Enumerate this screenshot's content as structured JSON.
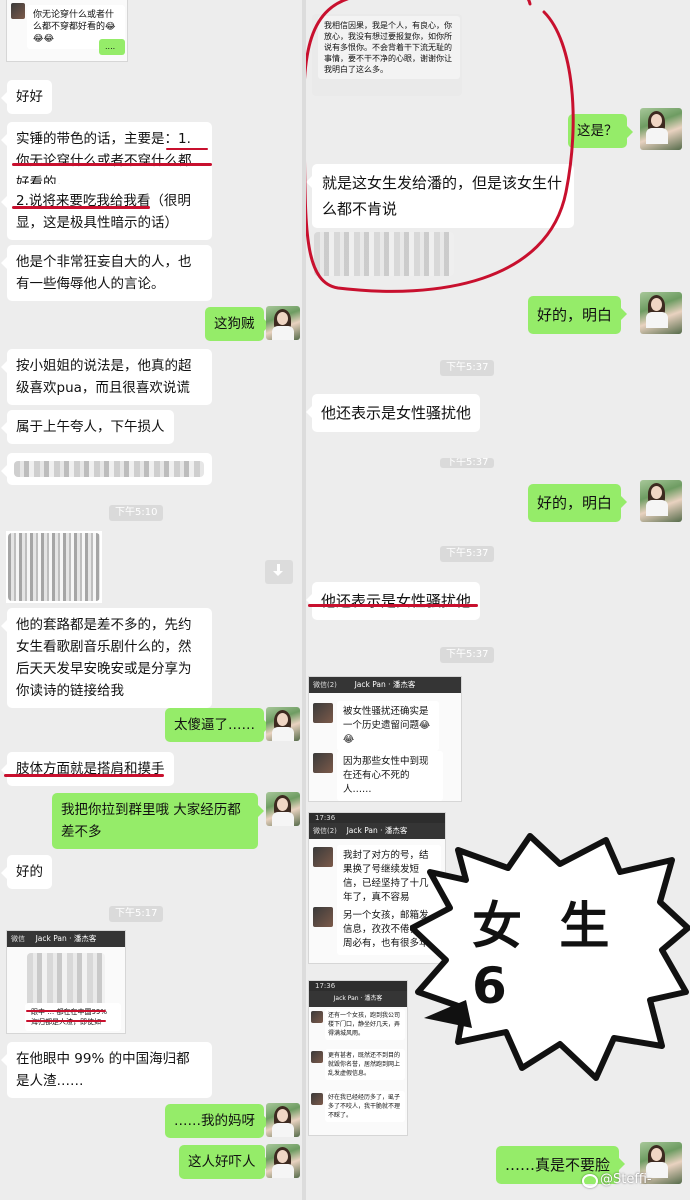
{
  "left": {
    "top_shot_text": "你无论穿什么或者什么都不穿都好看的😂😂😂",
    "msgs": {
      "haohao": "好好",
      "p1": "实锤的带色的话，主要是：1.你无论穿什么或者不穿什么都好看的。",
      "p2": "2.说将来要吃我给我看（很明显，这是极具性暗示的话）",
      "p3": "他是个非常狂妄自大的人，也有一些侮辱他人的言论。",
      "gouzei": "这狗贼",
      "p4": "按小姐姐的说法是，他真的超级喜欢pua，而且很喜欢说谎",
      "p5": "属于上午夸人，下午损人",
      "p6": "他的套路都是差不多的，先约女生看歌剧音乐剧什么的，然后天天发早安晚安或是分享为你读诗的链接给我",
      "shabi": "太傻逼了……",
      "p7": "肢体方面就是搭肩和摸手",
      "p8": "我把你拉到群里哦 大家经历都差不多",
      "haode": "好的",
      "p9": "在他眼中 99% 的中国海归都是人渣……",
      "mama": "……我的妈呀",
      "xiaren": "这人好吓人"
    },
    "timestamps": {
      "t1": "下午5:10",
      "t2": "下午5:17"
    },
    "shot2": {
      "title": "Jack Pan · 潘杰客",
      "back": "微信",
      "lines": "跟中 … 都在在中国99% 海归都是人渣，即使如"
    }
  },
  "right": {
    "top_shot_text": "我相信因果，我是个人，有良心，你放心，我没有想过要报复你，如你所说有多恨你。不会背着干下流无耻的事情，要不干不净的心眼，谢谢你让我明白了这么多。",
    "msgs": {
      "zheshi": "这是？",
      "p1": "就是这女生发给潘的，但是该女生什么都不肯说",
      "haode1": "好的，明白",
      "p2": "他还表示是女性骚扰他",
      "haode2": "好的，明白",
      "p3": "他还表示是女性骚扰他",
      "zhenshi": "……真是不要脸"
    },
    "timestamps": {
      "t1": "下午5:37",
      "t2": "下午5:37",
      "t3": "下午5:37",
      "t4": "下午5:37"
    },
    "shot_a": {
      "back": "微信(2)",
      "title": "Jack Pan · 潘杰客",
      "m1": "被女性骚扰还确实是一个历史遗留问题😂😂",
      "m2": "因为那些女性中到现在还有心不死的人……"
    },
    "shot_b": {
      "time": "17:36",
      "back": "微信(2)",
      "title": "Jack Pan · 潘杰客",
      "m1": "我封了对方的号，结果换了号继续发短信，已经坚持了十几年了，真不容易",
      "m2": "另一个女孩，邮箱发信息，孜孜不倦，每周必有，也有很多年"
    },
    "shot_c": {
      "time": "17:36",
      "title": "Jack Pan · 潘杰客",
      "m1": "还有一个女孩，跑到我公司楼下门口，静坐好几天，弄得满城风雨。",
      "m2": "更有甚者，既然还不到目的就毁你名誉，居然跑到网上乱发虚假信息。",
      "m3": "好在我已经经历多了，虱子多了不咬人，我干脆就不理不睬了。"
    }
  },
  "sticker": {
    "text": "女 生 6"
  },
  "watermark": {
    "text": "@Steffi-"
  },
  "colors": {
    "out_bubble": "#95ec69",
    "in_bubble": "#ffffff",
    "annotation_red": "#c8102e",
    "background": "#ededed"
  }
}
